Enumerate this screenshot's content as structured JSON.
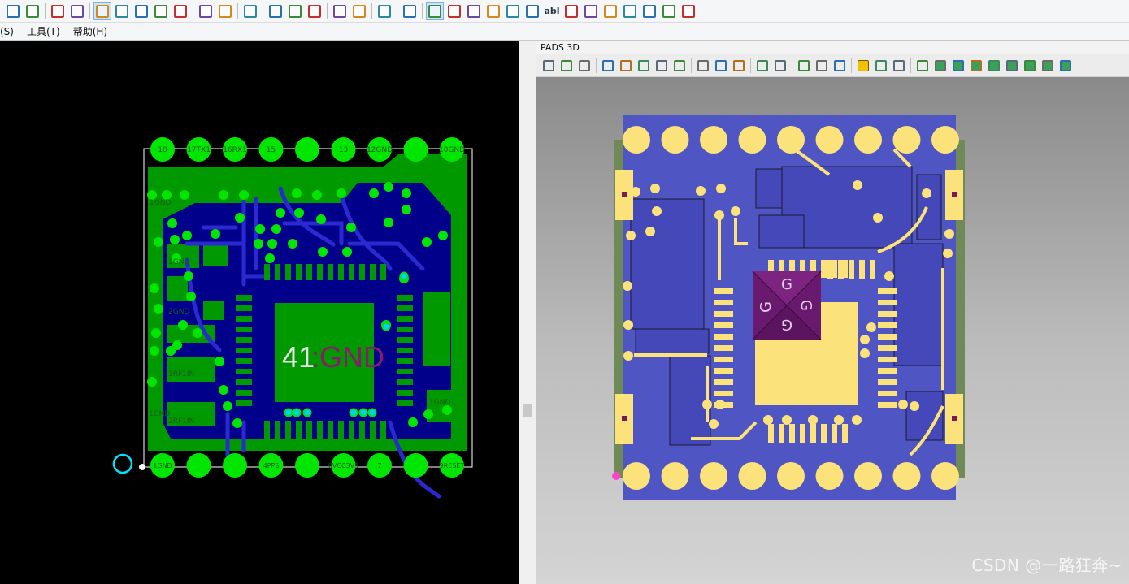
{
  "toolbar": {
    "buttons": [
      {
        "name": "properties-icon"
      },
      {
        "name": "refresh-icon"
      },
      {
        "sep": true
      },
      {
        "name": "copy-icon"
      },
      {
        "name": "paste-icon"
      },
      {
        "sep": true
      },
      {
        "name": "layer-view-icon",
        "active": true
      },
      {
        "name": "trace-icon"
      },
      {
        "name": "plane-icon"
      },
      {
        "name": "route-icon"
      },
      {
        "name": "fanout-icon"
      },
      {
        "sep": true
      },
      {
        "name": "undo-icon"
      },
      {
        "name": "redo-icon"
      },
      {
        "sep": true
      },
      {
        "name": "zoom-icon"
      },
      {
        "sep": true
      },
      {
        "name": "view-3d-icon"
      },
      {
        "name": "highlight-icon"
      },
      {
        "name": "brush-icon"
      },
      {
        "sep": true
      },
      {
        "name": "report-icon"
      },
      {
        "name": "window-icon"
      },
      {
        "sep": true
      },
      {
        "name": "drc-icon"
      },
      {
        "sep": true
      },
      {
        "name": "design-toolbar-icon"
      },
      {
        "sep": true
      },
      {
        "name": "select-arrow-icon",
        "active": true
      },
      {
        "name": "select-pin-icon"
      },
      {
        "name": "add-trace-icon"
      },
      {
        "name": "add-copper-icon"
      },
      {
        "name": "add-drafting-icon"
      },
      {
        "name": "no-entry-icon"
      },
      {
        "name": "add-text-icon",
        "text": "abl"
      },
      {
        "name": "add-part-icon"
      },
      {
        "name": "book-icon"
      },
      {
        "name": "flag-icon"
      },
      {
        "name": "component-icon"
      },
      {
        "name": "cut-icon"
      },
      {
        "name": "settings-icon"
      },
      {
        "name": "list-icon"
      }
    ]
  },
  "menubar": {
    "items": [
      {
        "label": "(S)",
        "clip": true
      },
      {
        "label": "工具(T)"
      },
      {
        "label": "帮助(H)"
      }
    ]
  },
  "pcb": {
    "top_pins": [
      "18",
      "17TX1",
      "16RX1",
      "15",
      "",
      "13",
      "12GND",
      "",
      "10GND"
    ],
    "bottom_pins": [
      "1GND",
      "",
      "",
      "4PPS",
      "",
      "6VCC3V3",
      "7",
      "",
      "9RESET"
    ],
    "center_label": {
      "num": "41",
      "net": "GND"
    },
    "side_labels": [
      "1GND",
      "2GND",
      "1RF1IN",
      "2RF1IN",
      "1GND",
      "1GND",
      "1GND"
    ]
  },
  "pads3d": {
    "title": "PADS 3D",
    "toolbar_icons": [
      "hand-icon",
      "rotate-left-icon",
      "rotate-right-icon",
      "pan-icon",
      "save-view-icon",
      "print-icon",
      "camera-icon",
      "hide-icon",
      "move-icon",
      "align-icon",
      "measure-icon",
      "find-icon",
      "print-preview-icon",
      "pencil-icon",
      "dimension-icon",
      "clearance-icon",
      "warning-icon",
      "report-icon",
      "export-icon",
      "settings-icon",
      "iso-view-icon",
      "top-view-icon",
      "front-view-icon",
      "right-view-icon",
      "bottom-view-icon",
      "back-view-icon",
      "left-view-icon",
      "fit-view-icon"
    ],
    "chip_marks": [
      "G",
      "G",
      "G",
      "G"
    ]
  },
  "watermark": "CSDN @一路狂奔~",
  "colors": {
    "pcb_bg": "#000000",
    "copper_green": "#009a00",
    "pad_green": "#00e600",
    "trace_blue": "#00008b",
    "board3d_blue": "#5055c4",
    "pad3d_yellow": "#fbe27a",
    "chip_purple": "#6a1a6e"
  }
}
